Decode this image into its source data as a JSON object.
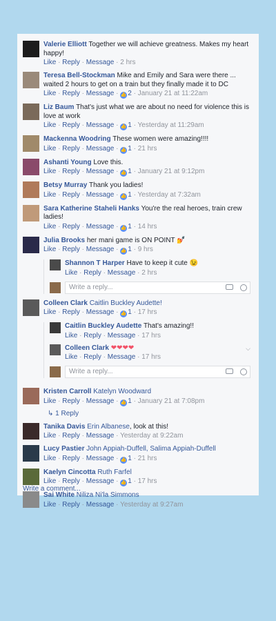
{
  "actions": {
    "like": "Like",
    "reply": "Reply",
    "message": "Message",
    "sep": "·"
  },
  "comments": [
    {
      "name": "Valerie Elliott",
      "text": "Together we will achieve greatness. Makes my heart happy!",
      "time": "2 hrs",
      "likes": ""
    },
    {
      "name": "Teresa Bell-Stockman",
      "text": "Mike and Emily and Sara were there ... waited 2 hours to get on a train but they finally made it to DC",
      "time": "January 21 at 11:22am",
      "likes": "2"
    },
    {
      "name": "Liz Baum",
      "text": "That's just what we are about no need for violence this is love at work",
      "time": "Yesterday at 11:29am",
      "likes": "1"
    },
    {
      "name": "Mackenna Woodring",
      "text": "These women were amazing!!!!",
      "time": "21 hrs",
      "likes": "1"
    },
    {
      "name": "Ashanti Young",
      "text": "Love this.",
      "time": "January 21 at 9:12pm",
      "likes": "1"
    },
    {
      "name": "Betsy Murray",
      "text": "Thank you ladies!",
      "time": "Yesterday at 7:32am",
      "likes": "1"
    },
    {
      "name": "Sara Katherine Staheli Hanks",
      "text": "You're the real heroes, train crew ladies!",
      "time": "14 hrs",
      "likes": "1"
    },
    {
      "name": "Julia Brooks",
      "text": "her mani game is ON POINT",
      "time": "9 hrs",
      "likes": "1"
    }
  ],
  "thread1": {
    "reply": {
      "name": "Shannon T Harper",
      "text": "Have to keep it cute",
      "time": "2 hrs"
    },
    "placeholder": "Write a reply..."
  },
  "colleen": {
    "name": "Colleen Clark",
    "tag": "Caitlin Buckley Audette!",
    "time": "17 hrs",
    "likes": "1"
  },
  "thread2": {
    "reply1": {
      "name": "Caitlin Buckley Audette",
      "text": "That's amazing!!",
      "time": "17 hrs"
    },
    "reply2": {
      "name": "Colleen Clark",
      "text": "",
      "time": "17 hrs"
    },
    "placeholder": "Write a reply..."
  },
  "kristen": {
    "name": "Kristen Carroll",
    "tag": "Katelyn Woodward",
    "time": "January 21 at 7:08pm",
    "likes": "1"
  },
  "replies_link": "1 Reply",
  "later": [
    {
      "name": "Tanika Davis",
      "tag": "Erin Albanese",
      "text": ", look at this!",
      "time": "Yesterday at 9:22am",
      "likes": ""
    },
    {
      "name": "Lucy Pastier",
      "tag": "John Appiah-Duffell, Salima Appiah-Duffell",
      "text": "",
      "time": "21 hrs",
      "likes": "1"
    },
    {
      "name": "Kaelyn Cincotta",
      "tag": "Ruth Farfel",
      "text": "",
      "time": "17 hrs",
      "likes": "1"
    },
    {
      "name": "Sai White",
      "tag": "Niliza Ni'la Simmons",
      "text": "",
      "time": "Yesterday at 9:27am",
      "likes": ""
    }
  ],
  "write_comment": "Write a comment..."
}
